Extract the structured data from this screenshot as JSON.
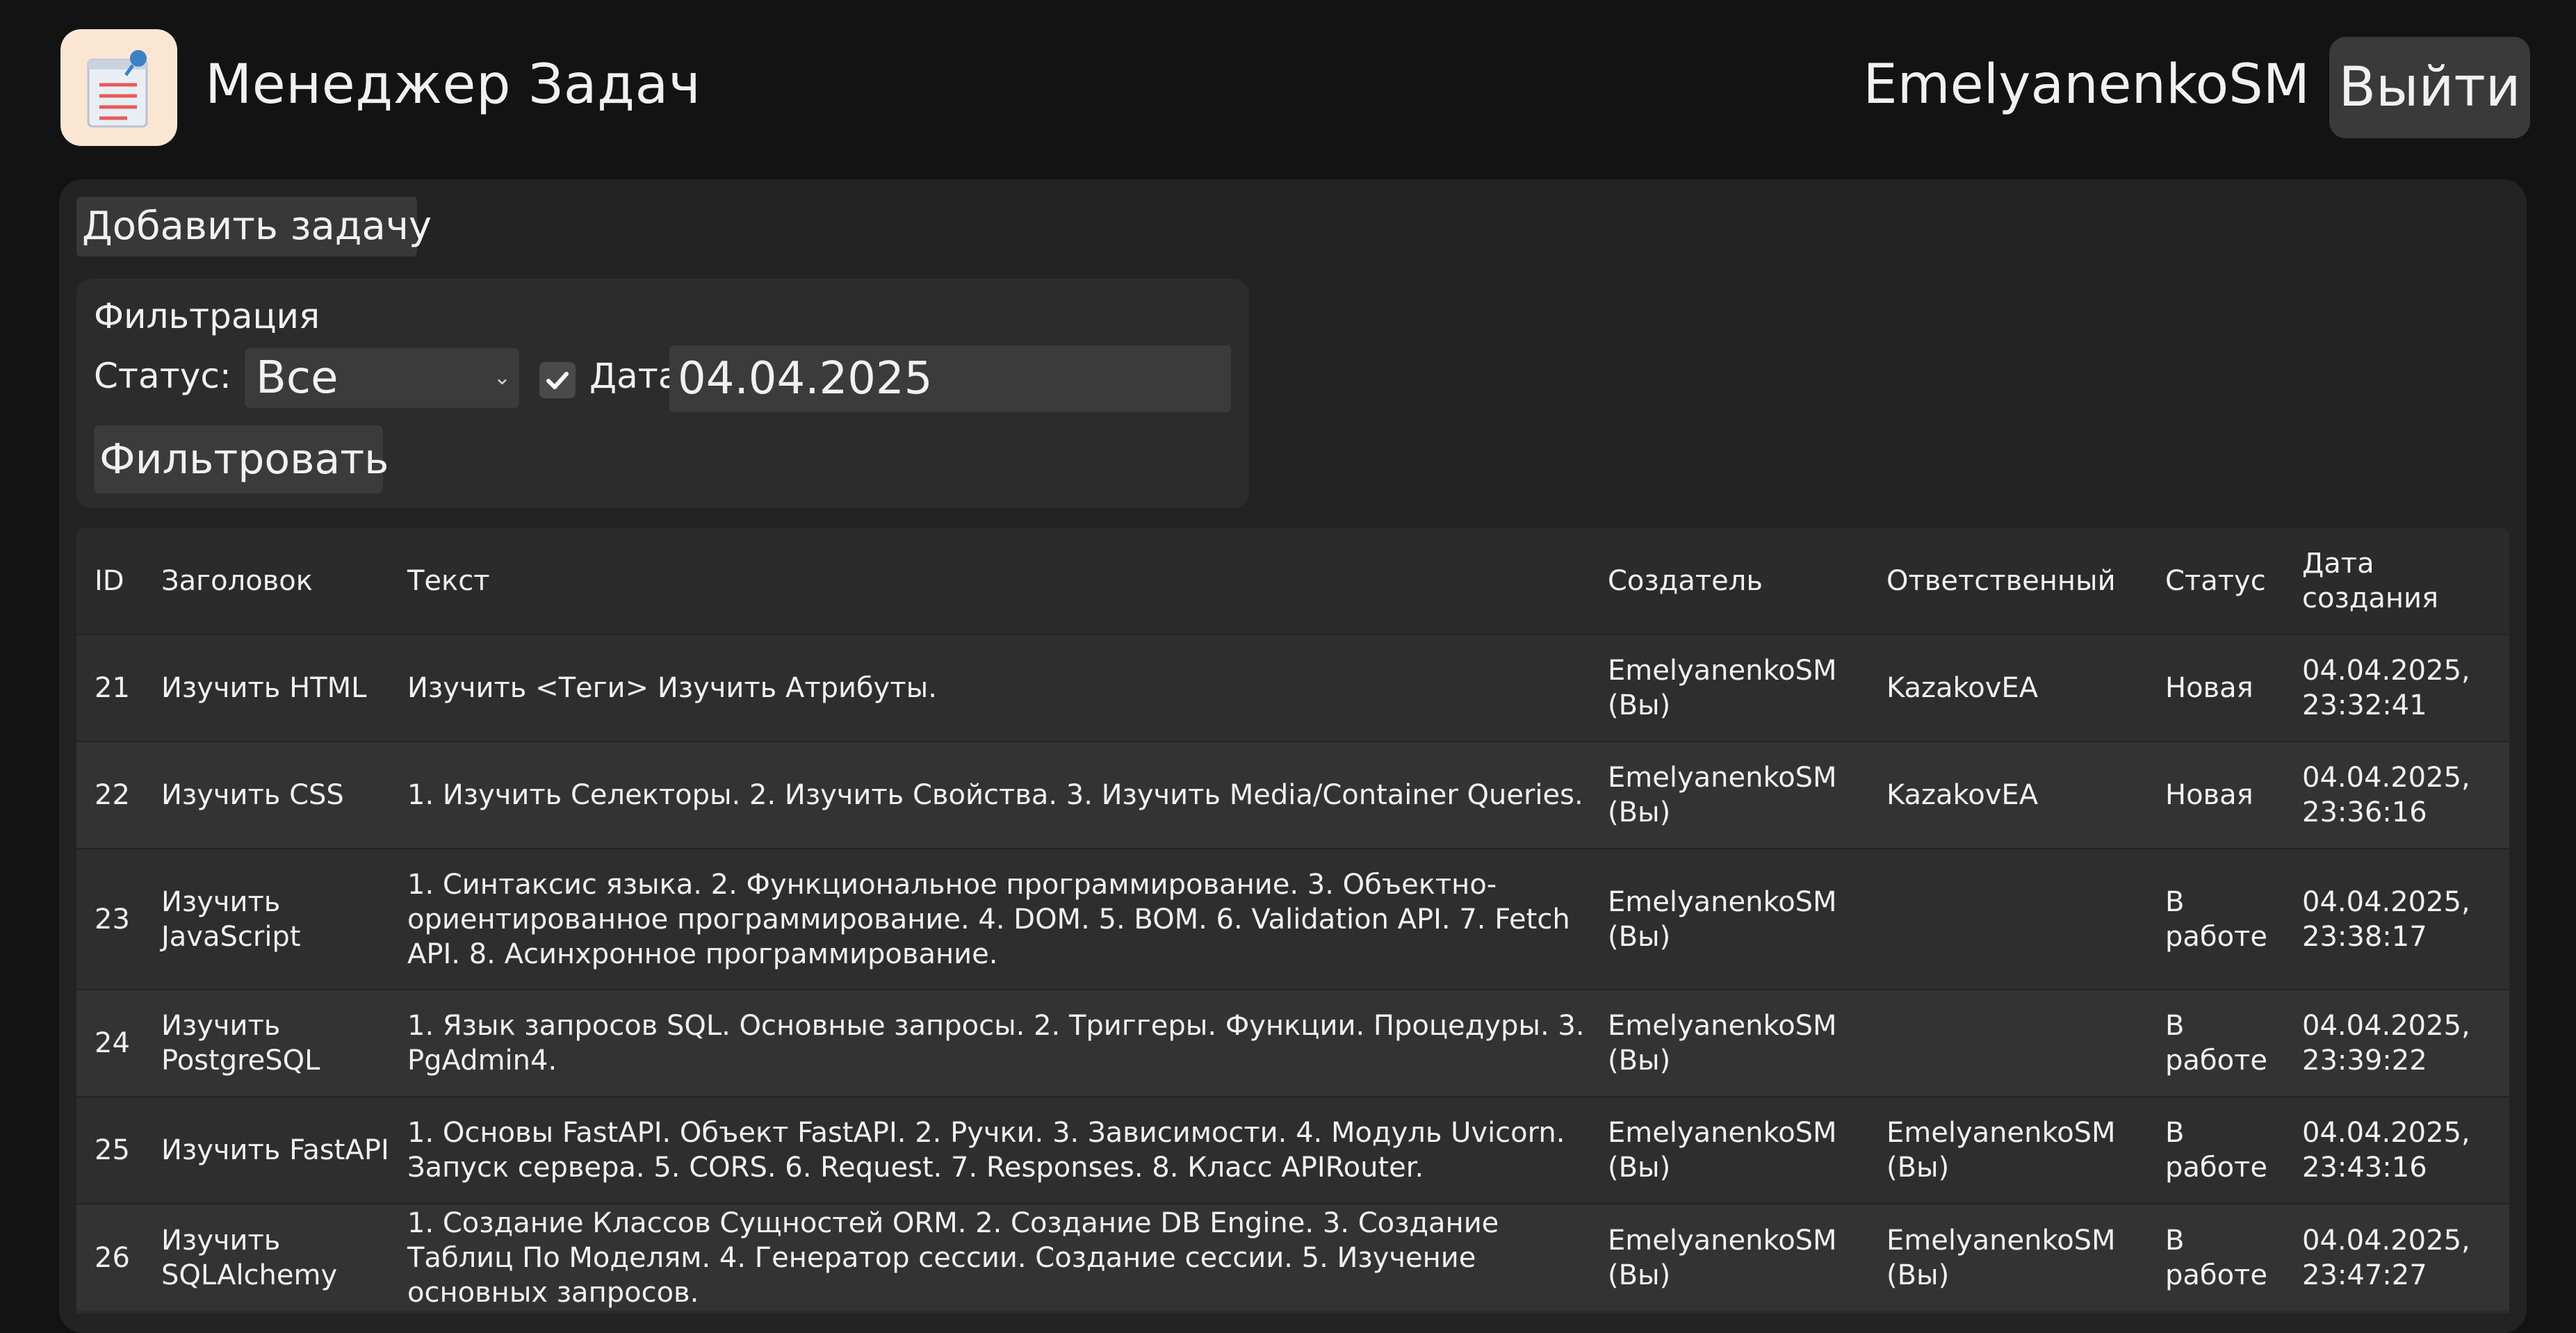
{
  "header": {
    "title": "Менеджер Задач",
    "username": "EmelyanenkoSM",
    "logout_label": "Выйти",
    "logo_icon": "notepad-pin-icon"
  },
  "toolbar": {
    "add_task_label": "Добавить задачу"
  },
  "filter": {
    "title": "Фильтрация",
    "status_label": "Статус:",
    "status_value": "Все",
    "date_enabled": true,
    "date_label": "Дата:",
    "date_value": "04.04.2025",
    "submit_label": "Фильтровать"
  },
  "table": {
    "columns": [
      "ID",
      "Заголовок",
      "Текст",
      "Создатель",
      "Ответственный",
      "Статус",
      "Дата создания"
    ],
    "rows": [
      {
        "id": "21",
        "title": "Изучить HTML",
        "text": "Изучить <Теги> Изучить Атрибуты.",
        "creator": "EmelyanenkoSM (Вы)",
        "assignee": "KazakovEA",
        "status": "Новая",
        "created": "04.04.2025, 23:32:41"
      },
      {
        "id": "22",
        "title": "Изучить CSS",
        "text": "1. Изучить Селекторы. 2. Изучить Свойства. 3. Изучить Media/Container Queries.",
        "creator": "EmelyanenkoSM (Вы)",
        "assignee": "KazakovEA",
        "status": "Новая",
        "created": "04.04.2025, 23:36:16"
      },
      {
        "id": "23",
        "title": "Изучить JavaScript",
        "text": "1. Синтаксис языка. 2. Функциональное программирование. 3. Объектно-ориентированное программирование. 4. DOM. 5. BOM. 6. Validation API. 7. Fetch API. 8. Асинхронное программирование.",
        "creator": "EmelyanenkoSM (Вы)",
        "assignee": "",
        "status": "В работе",
        "created": "04.04.2025, 23:38:17"
      },
      {
        "id": "24",
        "title": "Изучить PostgreSQL",
        "text": "1. Язык запросов SQL. Основные запросы. 2. Триггеры. Функции. Процедуры. 3. PgAdmin4.",
        "creator": "EmelyanenkoSM (Вы)",
        "assignee": "",
        "status": "В работе",
        "created": "04.04.2025, 23:39:22"
      },
      {
        "id": "25",
        "title": "Изучить FastAPI",
        "text": "1. Основы FastAPI. Объект FastAPI. 2. Ручки. 3. Зависимости. 4. Модуль Uvicorn. Запуск сервера. 5. CORS. 6. Request. 7. Responses. 8. Класс APIRouter.",
        "creator": "EmelyanenkoSM (Вы)",
        "assignee": "EmelyanenkoSM (Вы)",
        "status": "В работе",
        "created": "04.04.2025, 23:43:16"
      },
      {
        "id": "26",
        "title": "Изучить SQLAlchemy",
        "text": "1. Создание Классов Сущностей ORM. 2. Создание DB Engine. 3. Создание Таблиц По Моделям. 4. Генератор сессии. Создание сессии. 5. Изучение основных запросов.",
        "creator": "EmelyanenkoSM (Вы)",
        "assignee": "EmelyanenkoSM (Вы)",
        "status": "В работе",
        "created": "04.04.2025, 23:47:27"
      }
    ]
  },
  "colors": {
    "background": "#131313",
    "panel": "#232323",
    "filter_box": "#2c2c2c",
    "button": "#3a3a3a",
    "text": "#f1f1f1",
    "logo_bg": "#fbe6d4"
  }
}
